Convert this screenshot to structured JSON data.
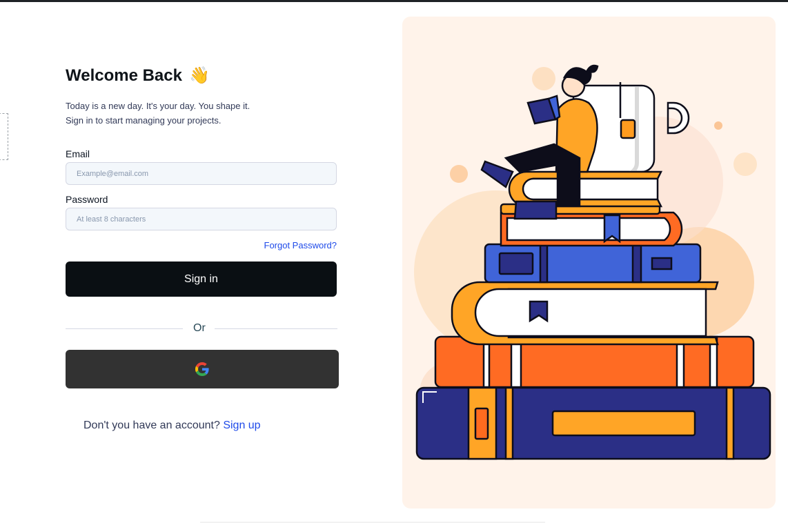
{
  "header": {
    "title": "Welcome Back",
    "wave_emoji": "👋",
    "subtitle_line1": "Today is a new day. It's your day. You shape it.",
    "subtitle_line2": "Sign in to start managing your projects."
  },
  "form": {
    "email_label": "Email",
    "email_placeholder": "Example@email.com",
    "email_value": "",
    "password_label": "Password",
    "password_placeholder": "At least 8 characters",
    "password_value": "",
    "forgot_password": "Forgot Password?",
    "sign_in_label": "Sign in",
    "divider_text": "Or",
    "google_icon": "google-logo"
  },
  "footer": {
    "no_account_text": "Don't you have an account?",
    "sign_up_link": "Sign up"
  },
  "illustration": {
    "subject": "person reading on stack of books with mug",
    "panel_color": "#fff3ea"
  },
  "colors": {
    "primary_button": "#0a0f13",
    "google_button": "#323232",
    "link": "#1e4ae9",
    "input_bg": "#f3f7fb"
  }
}
